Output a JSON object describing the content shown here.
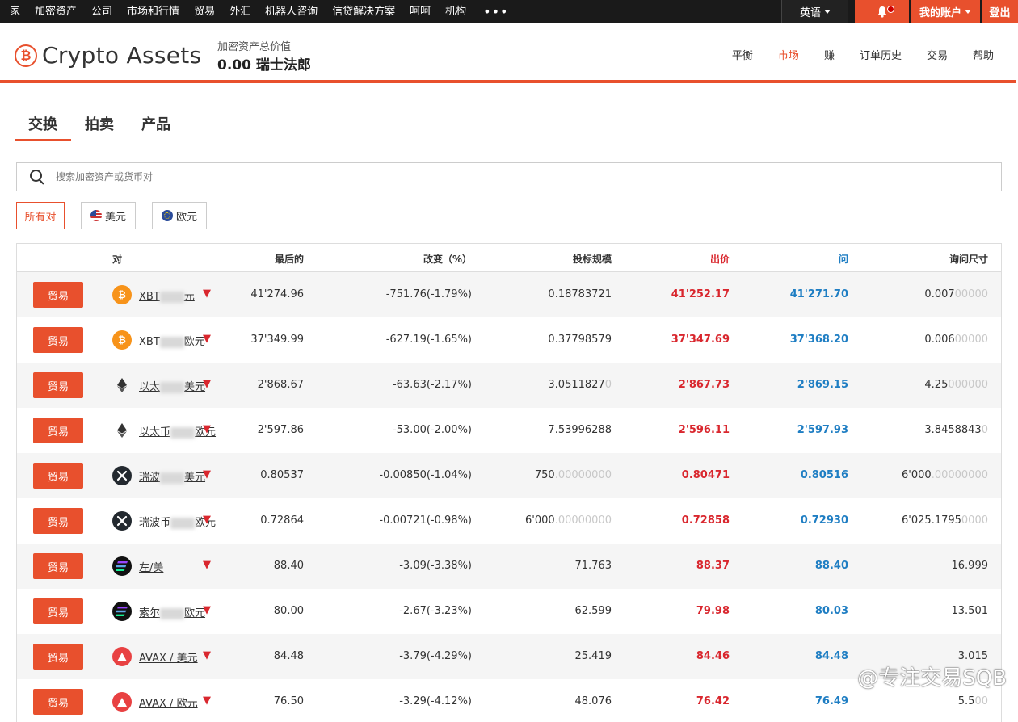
{
  "topnav": {
    "items": [
      "家",
      "加密资产",
      "公司",
      "市场和行情",
      "贸易",
      "外汇",
      "机器人咨询",
      "信贷解决方案",
      "呵呵",
      "机构"
    ],
    "more": "•••",
    "language": "英语",
    "account": "我的账户",
    "logout": "登出"
  },
  "header": {
    "logo_text": "Crypto Assets",
    "balance_label": "加密资产总价值",
    "balance_value": "0.00 瑞士法郎",
    "nav": [
      "平衡",
      "市场",
      "赚",
      "订单历史",
      "交易",
      "帮助"
    ],
    "active_nav": "市场"
  },
  "tabs": [
    "交换",
    "拍卖",
    "产品"
  ],
  "search": {
    "placeholder": "搜索加密资产或货币对"
  },
  "filters": [
    "所有对",
    "美元",
    "欧元"
  ],
  "table": {
    "headers": {
      "pair": "对",
      "last": "最后的",
      "change": "改变（%）",
      "volume": "投标规模",
      "bid": "出价",
      "ask": "问",
      "size": "询问尺寸"
    },
    "trade_label": "贸易",
    "rows": [
      {
        "icon": "btc",
        "pair_a": "XBT",
        "pair_b": "元",
        "last": "41'274.96",
        "change": "-751.76(-1.79%)",
        "vol": "0.18783721",
        "vol_fade": "",
        "bid": "41'252.17",
        "ask": "41'271.70",
        "size": "0.007",
        "size_fade": "00000"
      },
      {
        "icon": "btc",
        "pair_a": "XBT",
        "pair_b": "欧元",
        "last": "37'349.99",
        "change": "-627.19(-1.65%)",
        "vol": "0.37798579",
        "vol_fade": "",
        "bid": "37'347.69",
        "ask": "37'368.20",
        "size": "0.006",
        "size_fade": "00000"
      },
      {
        "icon": "eth",
        "pair_a": "以太",
        "pair_b": "美元",
        "last": "2'868.67",
        "change": "-63.63(-2.17%)",
        "vol": "3.0511827",
        "vol_fade": "0",
        "bid": "2'867.73",
        "ask": "2'869.15",
        "size": "4.25",
        "size_fade": "000000"
      },
      {
        "icon": "eth",
        "pair_a": "以太币",
        "pair_b": "欧元",
        "last": "2'597.86",
        "change": "-53.00(-2.00%)",
        "vol": "7.53996288",
        "vol_fade": "",
        "bid": "2'596.11",
        "ask": "2'597.93",
        "size": "3.8458843",
        "size_fade": "0"
      },
      {
        "icon": "xrp",
        "pair_a": "瑞波",
        "pair_b": "美元",
        "last": "0.80537",
        "change": "-0.00850(-1.04%)",
        "vol": "750",
        "vol_fade": ".00000000",
        "bid": "0.80471",
        "ask": "0.80516",
        "size": "6'000",
        "size_fade": ".00000000"
      },
      {
        "icon": "xrp",
        "pair_a": "瑞波币",
        "pair_b": "欧元",
        "last": "0.72864",
        "change": "-0.00721(-0.98%)",
        "vol": "6'000",
        "vol_fade": ".00000000",
        "bid": "0.72858",
        "ask": "0.72930",
        "size": "6'025.1795",
        "size_fade": "0000"
      },
      {
        "icon": "sol",
        "pair_a": "左/美",
        "pair_b": "",
        "last": "88.40",
        "change": "-3.09(-3.38%)",
        "vol": "71.763",
        "vol_fade": "",
        "bid": "88.37",
        "ask": "88.40",
        "size": "16.999",
        "size_fade": ""
      },
      {
        "icon": "sol",
        "pair_a": "索尔",
        "pair_b": "欧元",
        "last": "80.00",
        "change": "-2.67(-3.23%)",
        "vol": "62.599",
        "vol_fade": "",
        "bid": "79.98",
        "ask": "80.03",
        "size": "13.501",
        "size_fade": ""
      },
      {
        "icon": "avax",
        "pair_a": "AVAX / 美元",
        "pair_b": "",
        "last": "84.48",
        "change": "-3.79(-4.29%)",
        "vol": "25.419",
        "vol_fade": "",
        "bid": "84.46",
        "ask": "84.48",
        "size": "3.015",
        "size_fade": ""
      },
      {
        "icon": "avax",
        "pair_a": "AVAX / 欧元",
        "pair_b": "",
        "last": "76.50",
        "change": "-3.29(-4.12%)",
        "vol": "48.076",
        "vol_fade": "",
        "bid": "76.42",
        "ask": "76.49",
        "size": "5.5",
        "size_fade": "00"
      }
    ]
  },
  "watermark": "@专注交易SQB"
}
